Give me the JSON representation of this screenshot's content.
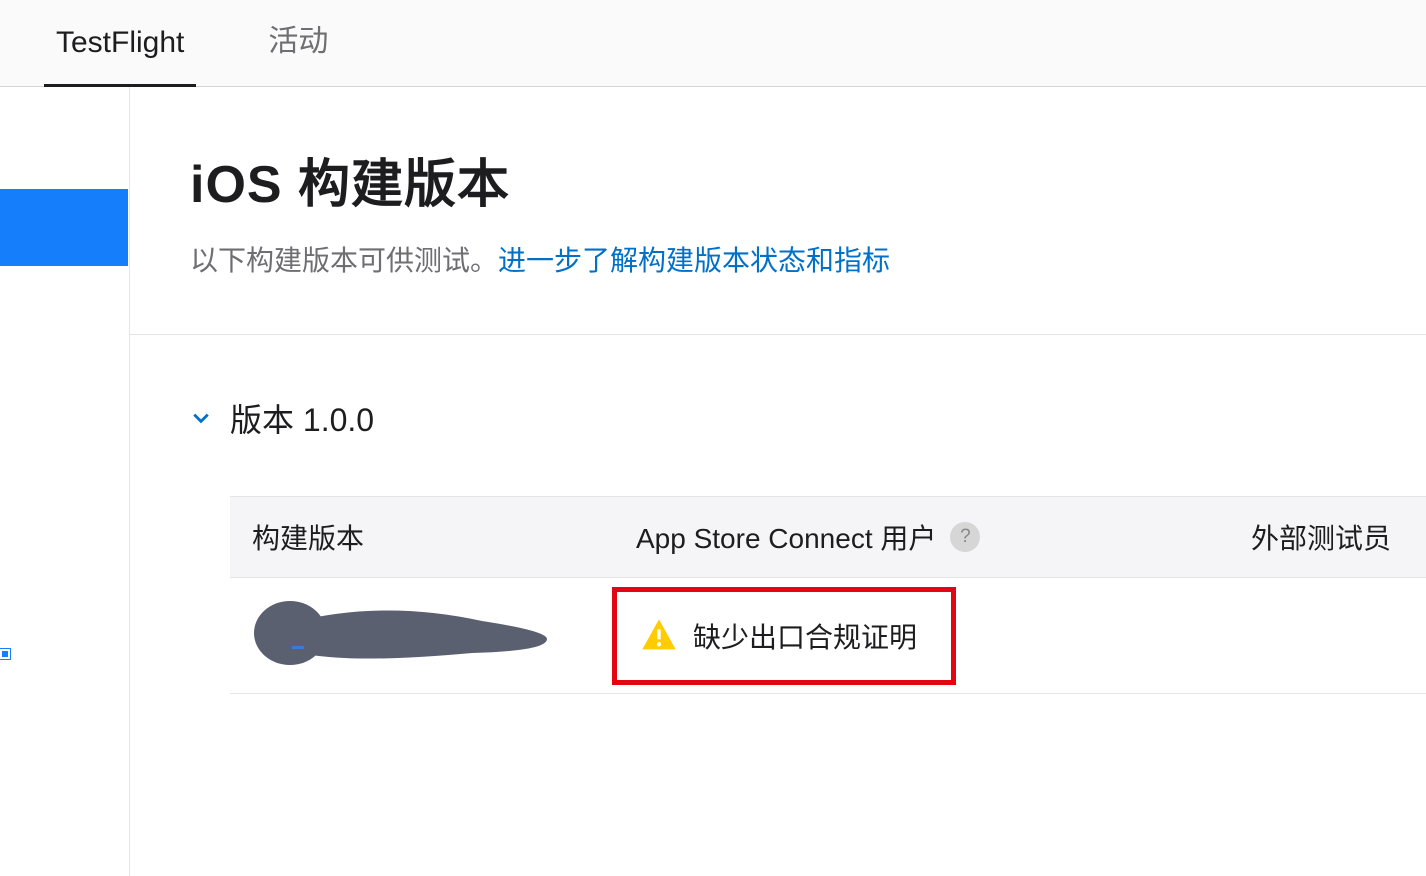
{
  "nav": {
    "tabs": [
      {
        "label": "TestFlight",
        "active": true
      },
      {
        "label": "活动",
        "active": false
      }
    ]
  },
  "page": {
    "title": "iOS 构建版本",
    "subtitle_text": "以下构建版本可供测试。",
    "subtitle_link": "进一步了解构建版本状态和指标"
  },
  "version": {
    "label": "版本 1.0.0"
  },
  "table": {
    "headers": {
      "build": "构建版本",
      "users": "App Store Connect 用户",
      "external": "外部测试员"
    },
    "row": {
      "status_text": "缺少出口合规证明"
    }
  },
  "icons": {
    "help": "?"
  }
}
